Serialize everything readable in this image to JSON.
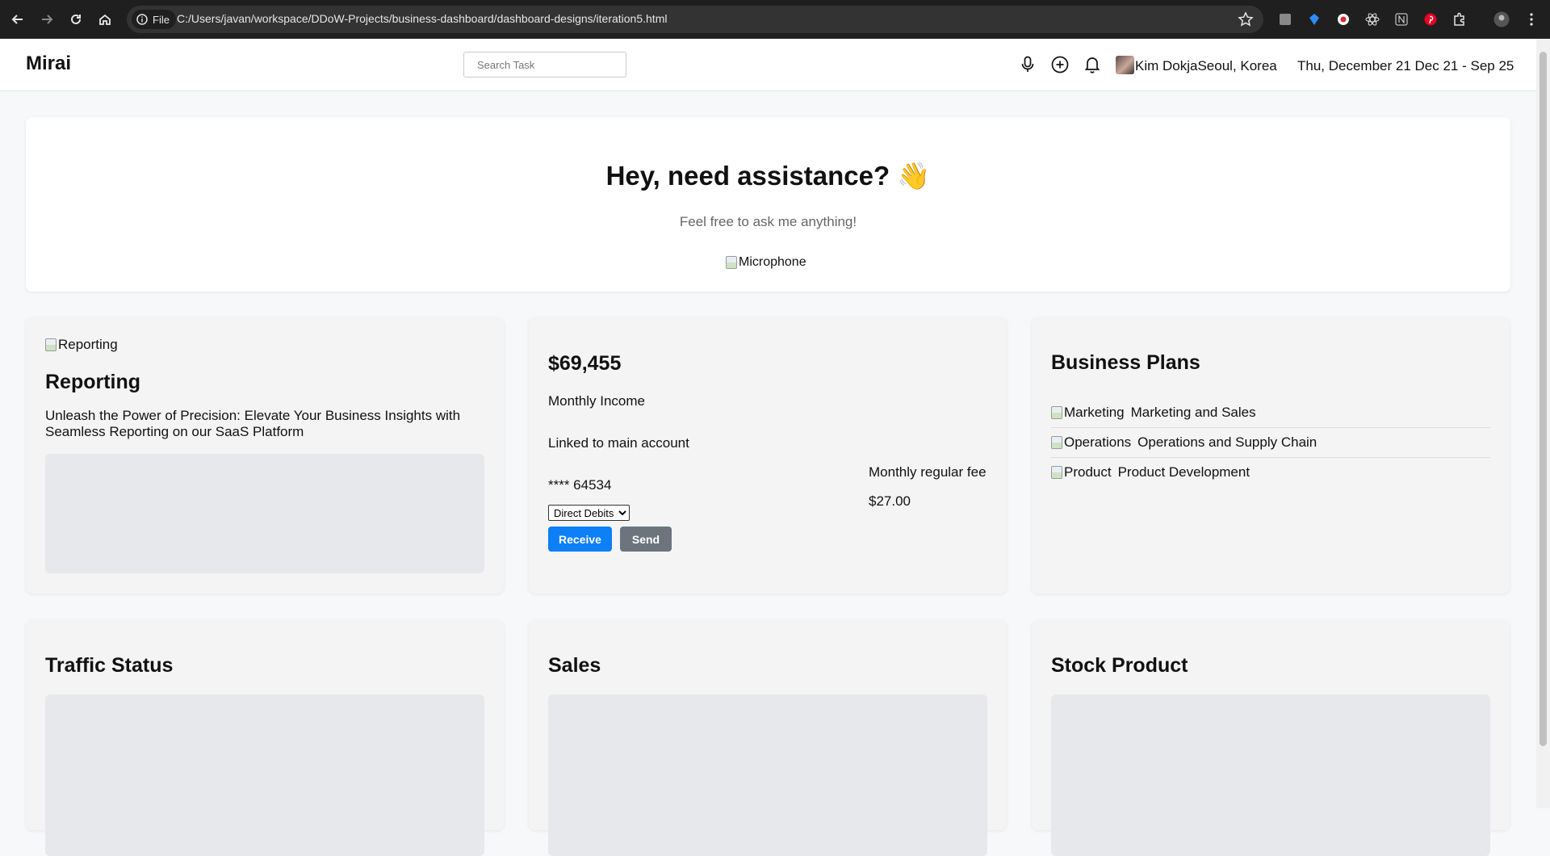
{
  "browser": {
    "site_chip": "File",
    "url": "C:/Users/javan/workspace/DDoW-Projects/business-dashboard/dashboard-designs/iteration5.html"
  },
  "header": {
    "brand": "Mirai",
    "search_placeholder": "Search Task",
    "user_info": "Kim DokjaSeoul, Korea",
    "date_range": "Thu, December 21 Dec 21 - Sep 25"
  },
  "hero": {
    "title": "Hey, need assistance? 👋",
    "subtitle": "Feel free to ask me anything!",
    "mic_alt": "Microphone"
  },
  "reporting": {
    "image_alt": "Reporting",
    "title": "Reporting",
    "description": "Unleash the Power of Precision: Elevate Your Business Insights with Seamless Reporting on our SaaS Platform"
  },
  "income": {
    "amount": "$69,455",
    "label": "Monthly Income",
    "linked": "Linked to main account",
    "account": "**** 64534",
    "fee_label": "Monthly regular fee",
    "fee_value": "$27.00",
    "select_value": "Direct Debits",
    "receive_label": "Receive",
    "send_label": "Send"
  },
  "plans": {
    "title": "Business Plans",
    "items": [
      {
        "alt": "Marketing",
        "label": "Marketing and Sales"
      },
      {
        "alt": "Operations",
        "label": "Operations and Supply Chain"
      },
      {
        "alt": "Product",
        "label": "Product Development"
      }
    ]
  },
  "bottom_cards": {
    "traffic": "Traffic Status",
    "sales": "Sales",
    "stock": "Stock Product"
  },
  "colors": {
    "primary_button": "#0d7ff7",
    "secondary_button": "#6c757d",
    "card_background": "#f4f4f4"
  }
}
